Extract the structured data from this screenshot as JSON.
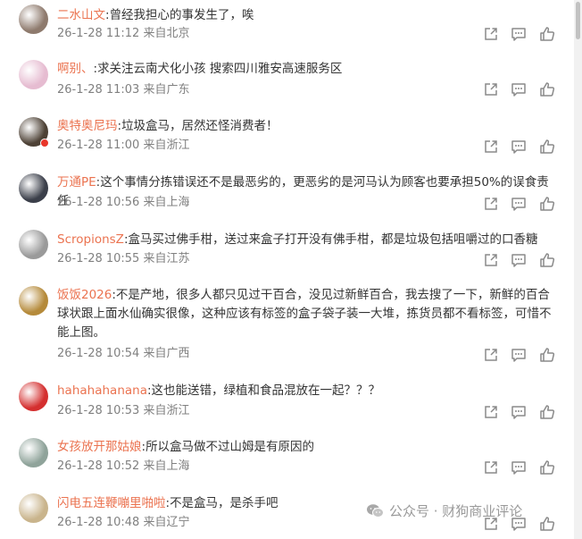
{
  "comments": [
    {
      "user": "二水山文",
      "text": "曾经我担心的事发生了，唉",
      "date": "26-1-28 11:12",
      "location": "来自北京",
      "avatar_color": "#8e7a6d"
    },
    {
      "user": "啊别、",
      "text": "求关注云南犬化小孩  搜索四川雅安高速服务区",
      "date": "26-1-28 11:03",
      "location": "来自广东",
      "avatar_color": "#e6bcd1"
    },
    {
      "user": "奥特奥尼玛",
      "text": "垃圾盒马，居然还怪消费者！",
      "date": "26-1-28 11:00",
      "location": "来自浙江",
      "avatar_color": "#4d4135",
      "verified": true
    },
    {
      "user": "万通PE",
      "text": "这个事情分拣错误还不是最恶劣的，更恶劣的是河马认为顾客也要承担50%的误食责任",
      "date": "26-1-28 10:56",
      "location": "来自上海",
      "avatar_color": "#3b3f4a"
    },
    {
      "user": "ScropionsZ",
      "text": "盒马买过佛手柑，送过来盒子打开没有佛手柑，都是垃圾包括咀嚼过的口香糖",
      "date": "26-1-28 10:55",
      "location": "来自江苏",
      "avatar_color": "#9a9a9a"
    },
    {
      "user": "饭饭2026",
      "text": "不是产地，很多人都只见过干百合，没见过新鲜百合，我去搜了一下，新鲜的百合球状跟上面水仙确实很像，这种应该有标签的盒子袋子装一大堆，拣货员都不看标签，可惜不能上图。",
      "date": "26-1-28 10:54",
      "location": "来自广西",
      "avatar_color": "#b58a3a"
    },
    {
      "user": "hahahahanana",
      "text": "这也能送错，绿植和食品混放在一起？？？",
      "date": "26-1-28 10:53",
      "location": "来自浙江",
      "avatar_color": "#d42f2f"
    },
    {
      "user": "女孩放开那姑娘",
      "text": "所以盒马做不过山姆是有原因的",
      "date": "26-1-28 10:52",
      "location": "来自上海",
      "avatar_color": "#8fa39a"
    },
    {
      "user": "闪电五连鞭嘣里啪啦",
      "text": "不是盒马，是杀手吧",
      "date": "26-1-28 10:48",
      "location": "来自辽宁",
      "avatar_color": "#c9b48c"
    }
  ],
  "actions": {
    "share_icon": "share-icon",
    "comment_icon": "comment-icon",
    "like_icon": "like-icon"
  },
  "watermark": {
    "text": "公众号 · 财狗商业评论",
    "icon": "wechat-icon"
  },
  "colors": {
    "username": "#eb7350",
    "meta": "#808080",
    "text": "#333333"
  }
}
